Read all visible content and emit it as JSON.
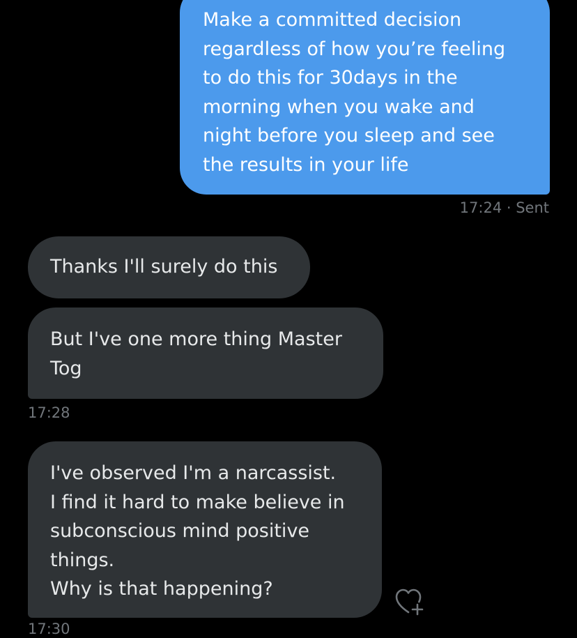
{
  "conversation": {
    "messages": [
      {
        "direction": "sent",
        "text": "Make a committed decision\nregardless of how you’re feeling\nto do this for 30days in the\nmorning when you wake and\nnight before you sleep and see\nthe results in your life"
      },
      {
        "direction": "received",
        "text": "Thanks I'll surely do this"
      },
      {
        "direction": "received",
        "text": "But I've one more thing Master\nTog"
      },
      {
        "direction": "received",
        "text": "I've observed I'm a  narcassist.\nI find it hard to make believe in\nsubconscious mind positive\nthings.\nWhy is that happening?"
      }
    ],
    "sent_status": "17:24 · Sent",
    "received_time": "17:28",
    "partial_time": "17:30"
  },
  "icons": {
    "react": "heart-plus-icon"
  },
  "colors": {
    "background": "#000000",
    "sent_bubble": "#4c9aec",
    "received_bubble": "#2f3336",
    "timestamp": "#71767b"
  }
}
